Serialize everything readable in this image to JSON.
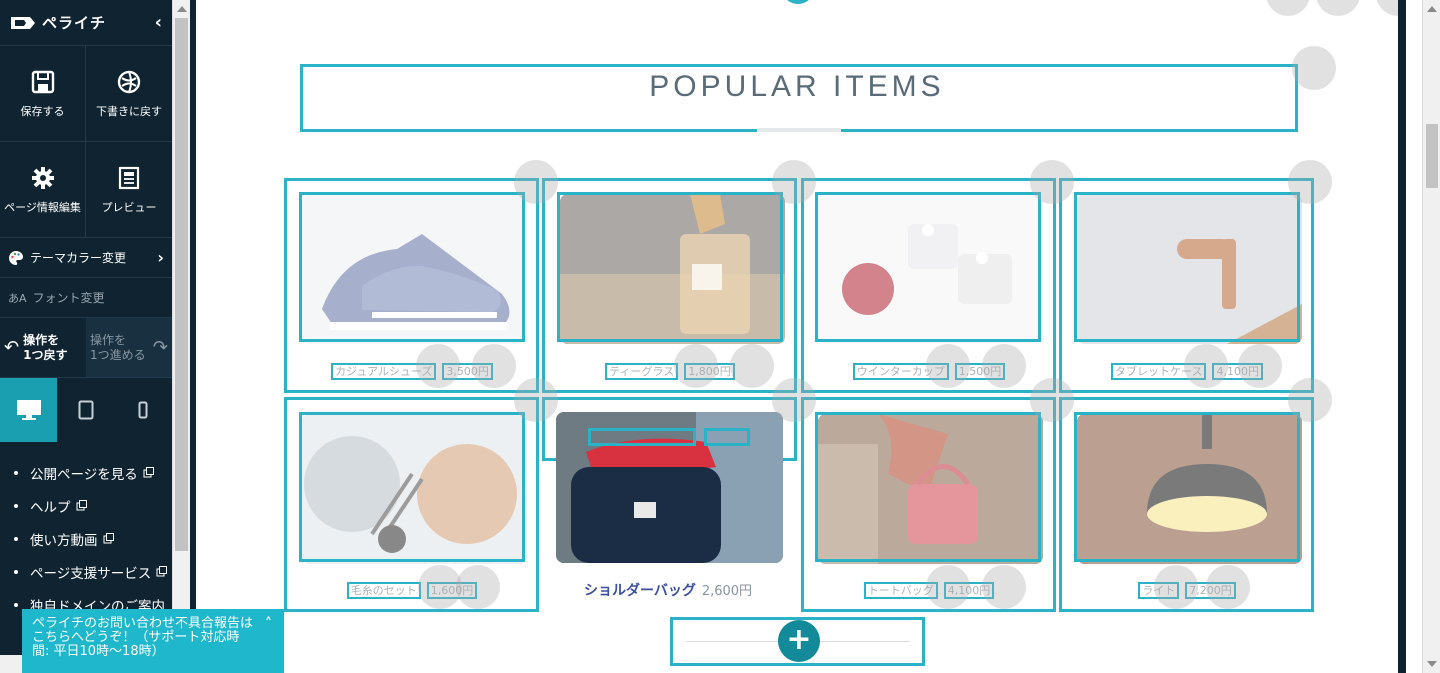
{
  "sidebar": {
    "brand": "ペライチ",
    "actions": [
      {
        "label": "保存する"
      },
      {
        "label": "下書きに戻す"
      },
      {
        "label": "ページ情報編集"
      },
      {
        "label": "プレビュー"
      }
    ],
    "theme_color": "テーマカラー変更",
    "font_change": "フォント変更",
    "undo_label_1": "操作を",
    "undo_label_2": "1つ戻す",
    "redo_label_1": "操作を",
    "redo_label_2": "1つ進める",
    "devices": [
      "desktop",
      "tablet",
      "mobile"
    ],
    "links": [
      {
        "label": "公開ページを見る",
        "external": true
      },
      {
        "label": "ヘルプ",
        "external": true
      },
      {
        "label": "使い方動画",
        "external": true
      },
      {
        "label": "ページ支援サービス",
        "external": true
      },
      {
        "label": "独自ドメインのご案内",
        "external": false
      }
    ]
  },
  "canvas": {
    "section_title": "POPULAR ITEMS",
    "products": [
      {
        "name": "カジュアルシューズ",
        "price": "3,500円",
        "image": "sneakers"
      },
      {
        "name": "ティーグラス",
        "price": "1,800円",
        "image": "glass"
      },
      {
        "name": "ウインターカップ",
        "price": "1,500円",
        "image": "cups"
      },
      {
        "name": "タブレットケース",
        "price": "4,100円",
        "image": "tablet-case"
      },
      {
        "name": "毛糸のセット",
        "price": "1,600円",
        "image": "yarn"
      },
      {
        "name": "ショルダーバッグ",
        "price": "2,600円",
        "image": "bag"
      },
      {
        "name": "トートバッグ",
        "price": "4,100円",
        "image": "handbag"
      },
      {
        "name": "ライト",
        "price": "7,200円",
        "image": "lamp"
      }
    ]
  },
  "support": {
    "text": "ペライチのお問い合わせ不具合報告はこちらへどうぞ！（サポート対応時間: 平日10時〜18時）"
  },
  "colors": {
    "sidebar_bg": "#0f2330",
    "accent": "#2ab3c6",
    "active_device": "#1a9fb0"
  }
}
